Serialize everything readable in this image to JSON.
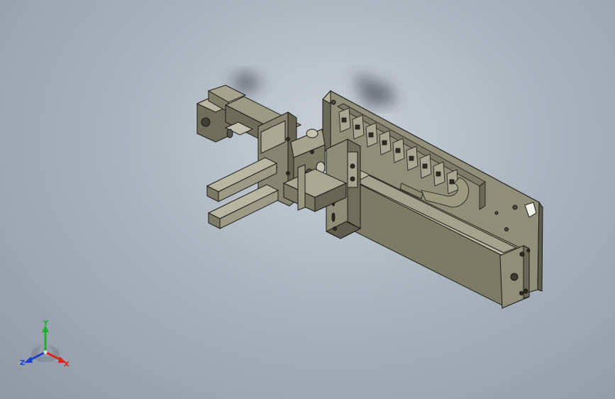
{
  "viewport": {
    "background_top": "#c9d0d8",
    "background_bottom": "#8f99a4",
    "part_color": "#8f8e78"
  },
  "model": {
    "components": [
      "base-plate",
      "linear-actuator-body",
      "drag-chain",
      "motor",
      "carriage-bracket",
      "gripper-cylinder",
      "gripper-finger-upper",
      "gripper-finger-lower"
    ]
  },
  "triad": {
    "x_label": "X",
    "y_label": "Y",
    "z_label": "Z",
    "x_color": "#d9261c",
    "y_color": "#1fae2c",
    "z_color": "#1f3fd1"
  }
}
